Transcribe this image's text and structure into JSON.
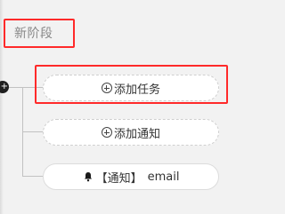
{
  "stage": {
    "title": "新阶段"
  },
  "node": {
    "toggle_glyph": "+"
  },
  "actions": {
    "add_task_label": "添加任务",
    "add_notice_label": "添加通知",
    "add_icon": "plus-circle-icon"
  },
  "notification_item": {
    "icon": "bell-icon",
    "tag": "【通知】",
    "channel": "email"
  },
  "colors": {
    "highlight": "#ff2a2a",
    "background": "#f2f2f2",
    "line": "#c2c2c2"
  }
}
